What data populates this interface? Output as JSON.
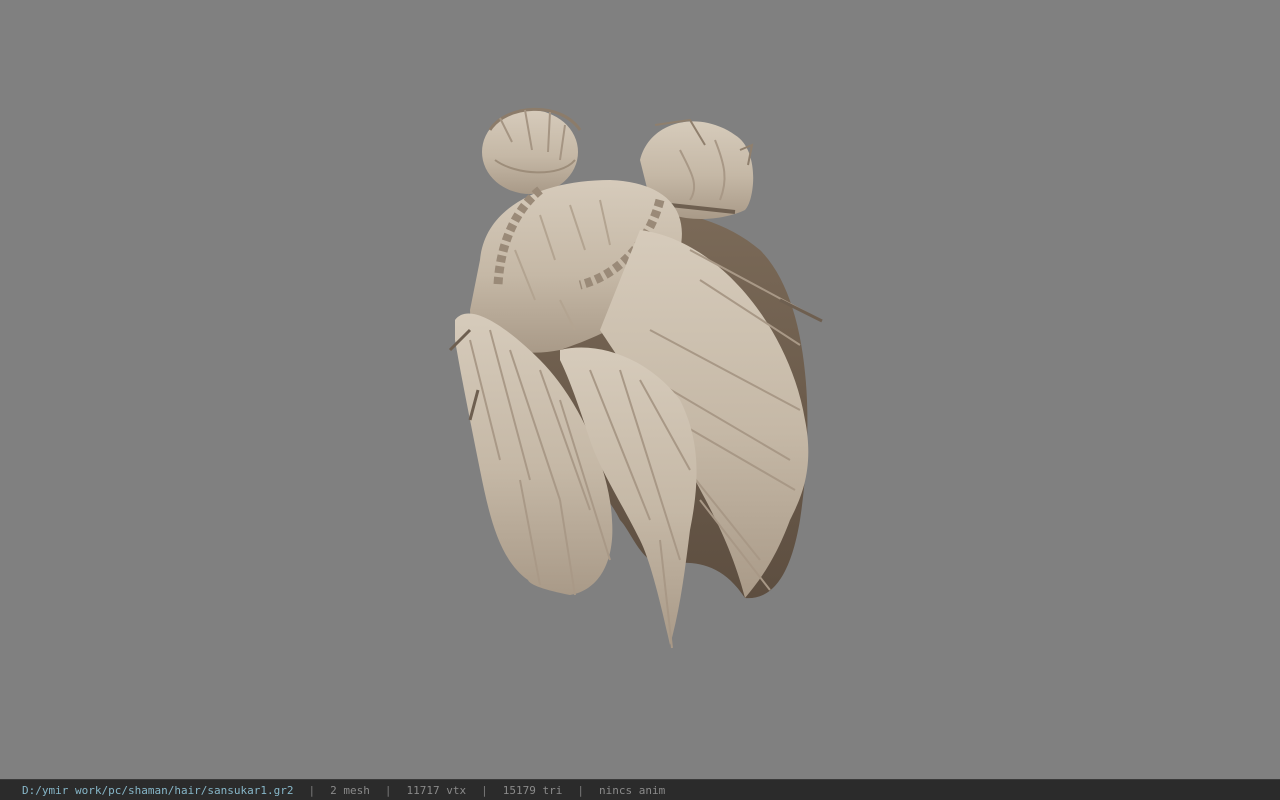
{
  "viewer": {
    "background_color": "#808080",
    "model": {
      "type": "hair",
      "icon": "hair-model-icon",
      "primary_color": "#c9bcaa",
      "shadow_color": "#6e5f50"
    }
  },
  "statusbar": {
    "file_path": "D:/ymir work/pc/shaman/hair/sansukar1.gr2",
    "separator": "|",
    "mesh_count": "2 mesh",
    "vertex_count": "11717 vtx",
    "triangle_count": "15179 tri",
    "anim_status": "nincs anim",
    "path_color": "#86b6c8",
    "text_color": "#8a8a8a"
  }
}
